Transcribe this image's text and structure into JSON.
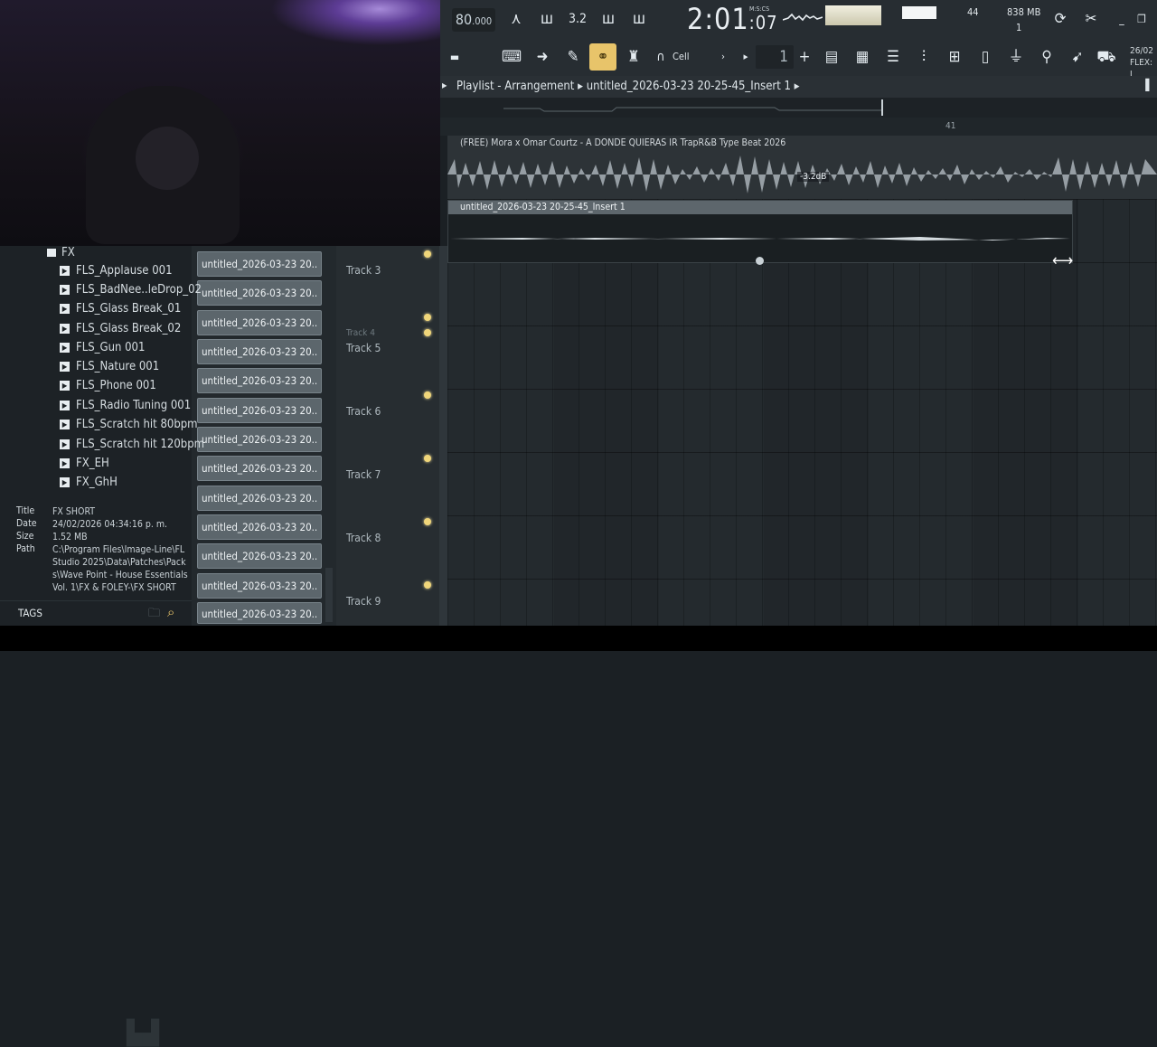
{
  "toolbar": {
    "tempo_main": "80",
    "tempo_frac": ".000",
    "time_main": "2:01",
    "time_sub": ":07",
    "time_format": "M:S:CS",
    "cpu_value": "44",
    "ram_value": "838 MB",
    "poly_value": "1",
    "snap_label": "Cell",
    "pattern_number": "1",
    "date_mini": "26/02",
    "flex_label": "FLEX: I"
  },
  "playlist": {
    "title": "Playlist - Arrangement",
    "breadcrumb": "untitled_2026-03-23 20-25-45_Insert 1",
    "ruler_bar": "41",
    "clip1_name": "(FREE) Mora x Omar Courtz - A DONDE QUIERAS IR  TrapR&B Type Beat 2026",
    "clip1_gain": "-3.2dB",
    "clip2_name": "untitled_2026-03-23 20-25-45_Insert 1"
  },
  "tracks": [
    {
      "label": "Track 3"
    },
    {
      "label": "Track 4"
    },
    {
      "label": "Track 5"
    },
    {
      "label": "Track 6"
    },
    {
      "label": "Track 7"
    },
    {
      "label": "Track 8"
    },
    {
      "label": "Track 9"
    }
  ],
  "pattern_items": [
    "untitled_2026-03-23 20..",
    "untitled_2026-03-23 20..",
    "untitled_2026-03-23 20..",
    "untitled_2026-03-23 20..",
    "untitled_2026-03-23 20..",
    "untitled_2026-03-23 20..",
    "untitled_2026-03-23 20..",
    "untitled_2026-03-23 20..",
    "untitled_2026-03-23 20..",
    "untitled_2026-03-23 20..",
    "untitled_2026-03-23 20..",
    "untitled_2026-03-23 20..",
    "untitled_2026-03-23 20.."
  ],
  "browser": {
    "folder": "FX",
    "items": [
      "FLS_Applause 001",
      "FLS_BadNee..leDrop_02",
      "FLS_Glass Break_01",
      "FLS_Glass Break_02",
      "FLS_Gun 001",
      "FLS_Nature 001",
      "FLS_Phone 001",
      "FLS_Radio Tuning 001",
      "FLS_Scratch hit 80bpm",
      "FLS_Scratch hit 120bpm",
      "FX_EH",
      "FX_GhH"
    ],
    "file_info": {
      "title_label": "Title",
      "title_value": "FX SHORT",
      "date_label": "Date",
      "date_value": "24/02/2026 04:34:16 p. m.",
      "size_label": "Size",
      "size_value": "1.52 MB",
      "path_label": "Path",
      "path_value": "C:\\Program Files\\Image-Line\\FL Studio 2025\\Data\\Patches\\Packs\\Wave Point - House Essentials Vol. 1\\FX & FOLEY-\\FX SHORT"
    },
    "tags_label": "TAGS"
  },
  "colors": {
    "accent": "#e8c46a",
    "clip_header": "#5d666c",
    "background": "#1b2024"
  }
}
